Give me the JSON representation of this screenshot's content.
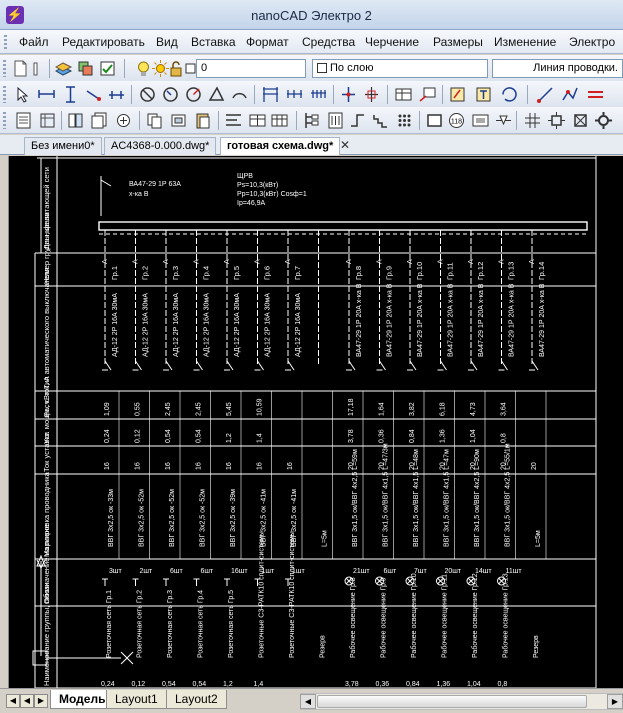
{
  "app": {
    "title": "nanoCAD Электро 2",
    "icon": "lightning-icon"
  },
  "menu": [
    "Файл",
    "Редактировать",
    "Вид",
    "Вставка",
    "Формат",
    "Средства",
    "Черчение",
    "Размеры",
    "Изменение",
    "Электро"
  ],
  "toolbar": {
    "layer_value": "0",
    "color_value": "По слою",
    "linetype_value": "Линия проводки."
  },
  "doc_tabs": [
    "Без имени0*",
    "AC4368-0.000.dwg*",
    "готовая схема.dwg*"
  ],
  "active_doc": "готовая схема.dwg*",
  "layout_tabs": [
    "Модель",
    "Layout1",
    "Layout2"
  ],
  "drawing": {
    "row_labels": {
      "supply": "Данные питающей сети",
      "group_no": "Номер группы, фаза",
      "breaker": "Тип автоматического выключателя",
      "calc_current": "Расч. ток, А",
      "power": "Уст. мощн., кВт",
      "cable_len": "Ток уставки",
      "conductor": "Маркировка проводника",
      "plan_symbol": "Обозначение на плане",
      "group_name": "Наименование группы, линии",
      "last": "Уст. мощн."
    },
    "supply_breaker": "ВА47-29 1Р 63А",
    "supply_breaker_type": "х-ка В",
    "panel_name": "ЩРВ",
    "panel_ps": "Рs=10,3(кВт)",
    "panel_pp": "Рр=10,3(кВт) Cosф=1",
    "panel_ip": "Iр=46,9А",
    "groups": [
      {
        "no": "Гр.1",
        "phase": "А",
        "breaker": "АД-12 2Р 16А 30мА",
        "current": "1,09",
        "power": "0,24",
        "setting": "16",
        "cable": "ВВГ 3х2,5 ок -33м",
        "symbol": "3шт",
        "name": "Розеточная сеть Гр.1",
        "bottom": "0,24"
      },
      {
        "no": "Гр.2",
        "phase": "А",
        "breaker": "АД-12 2Р 16А 30мА",
        "current": "0,55",
        "power": "0,12",
        "setting": "16",
        "cable": "ВВГ 3х2,5 ок -52м",
        "symbol": "2шт",
        "name": "Розеточная сеть Гр.2",
        "bottom": "0,12"
      },
      {
        "no": "Гр.3",
        "phase": "А",
        "breaker": "АД-12 2Р 16А 30мА",
        "current": "2,45",
        "power": "0,54",
        "setting": "16",
        "cable": "ВВГ 3х2,5 ок -52м",
        "symbol": "6шт",
        "name": "Розеточная сеть Гр.3",
        "bottom": "0,54"
      },
      {
        "no": "Гр.4",
        "phase": "А",
        "breaker": "АД-12 2Р 16А 30мА",
        "current": "2,45",
        "power": "0,54",
        "setting": "16",
        "cable": "ВВГ 3х2,5 ок -52м",
        "symbol": "6шт",
        "name": "Розеточная сеть Гр.4",
        "bottom": "0,54"
      },
      {
        "no": "Гр.5",
        "phase": "А",
        "breaker": "АД-12 2Р 16А 30мА",
        "current": "5,45",
        "power": "1,2",
        "setting": "16",
        "cable": "ВВГ 3х2,5 ок -39м",
        "symbol": "16шт",
        "name": "Розеточная сеть Гр.5",
        "bottom": "1,2"
      },
      {
        "no": "Гр.6",
        "phase": "А",
        "breaker": "АД-12 2Р 16А 30мА",
        "current": "10,59",
        "power": "1,4",
        "setting": "16",
        "cable": "ВВГ 3х2,5 ок -41м",
        "symbol": "1шт",
        "name": "Розеточные СЗ-РАТК10 сплит-системы",
        "bottom": "1,4"
      },
      {
        "no": "Гр.7",
        "phase": "А",
        "breaker": "АД-12 2Р 16А 30мА",
        "current": "",
        "power": "",
        "setting": "16",
        "cable": "ВВГ 3х2,5 ок -41м",
        "symbol": "1шт",
        "name": "Розеточные СЗ-РАТК10 сплит-системы",
        "bottom": ""
      },
      {
        "no": "",
        "phase": "",
        "breaker": "",
        "current": "",
        "power": "",
        "setting": "",
        "cable": "L=5м",
        "symbol": "",
        "name": "Резерв",
        "bottom": ""
      },
      {
        "no": "Гр.8",
        "phase": "А",
        "breaker": "ВА47-29 1Р 20А х-ка В",
        "current": "17,18",
        "power": "3,78",
        "setting": "20",
        "cable": "ВВГ 3х1,5 ок/ВВГ 4х2,5 L=59м",
        "symbol": "21шт",
        "name": "Рабочее освещение Гр.8",
        "bottom": "3,78"
      },
      {
        "no": "Гр.9",
        "phase": "А",
        "breaker": "ВА47-29 1Р 20А х-ка В",
        "current": "1,64",
        "power": "0,36",
        "setting": "20",
        "cable": "ВВГ 3х1,5 ок/ВВГ 4х1,5 L=47/3м",
        "symbol": "6шт",
        "name": "Рабочее освещение Гр.9",
        "bottom": "0,36"
      },
      {
        "no": "Гр.10",
        "phase": "А",
        "breaker": "ВА47-29 1Р 20А х-ка В",
        "current": "3,82",
        "power": "0,84",
        "setting": "20",
        "cable": "ВВГ 3х1,5 ок/ВВГ 4х1,5 L=48м",
        "symbol": "7шт",
        "name": "Рабочее освещение Гр.10",
        "bottom": "0,84"
      },
      {
        "no": "Гр.11",
        "phase": "А",
        "breaker": "ВА47-29 1Р 20А х-ка В",
        "current": "6,18",
        "power": "1,36",
        "setting": "20",
        "cable": "ВВГ 3х1,5 ок/ВВГ 4х1,5 L=47м",
        "symbol": "20шт",
        "name": "Рабочее освещение Гр.11",
        "bottom": "1,36"
      },
      {
        "no": "Гр.12",
        "phase": "А",
        "breaker": "ВА47-29 1Р 20А х-ка В",
        "current": "4,73",
        "power": "1,04",
        "setting": "20",
        "cable": "ВВГ 3х1,5 ок/ВВГ 4х2,5 L=90м",
        "symbol": "14шт",
        "name": "Рабочее освещение Гр.12",
        "bottom": "1,04"
      },
      {
        "no": "Гр.13",
        "phase": "А",
        "breaker": "ВА47-29 1Р 20А х-ка В",
        "current": "3,64",
        "power": "0,8",
        "setting": "20",
        "cable": "ВВГ 3х1,5 ок/ВВГ 4х2,5 L=55/1м",
        "symbol": "11шт",
        "name": "Рабочее освещение Гр.13",
        "bottom": "0,8"
      },
      {
        "no": "Гр.14",
        "phase": "А",
        "breaker": "ВА47-29 1Р 20А х-ка В",
        "current": "",
        "power": "",
        "setting": "20",
        "cable": "L=5м",
        "symbol": "",
        "name": "Резерв",
        "bottom": ""
      }
    ]
  },
  "colors": {
    "canvas_bg": "#000000",
    "line": "#ffffff"
  }
}
